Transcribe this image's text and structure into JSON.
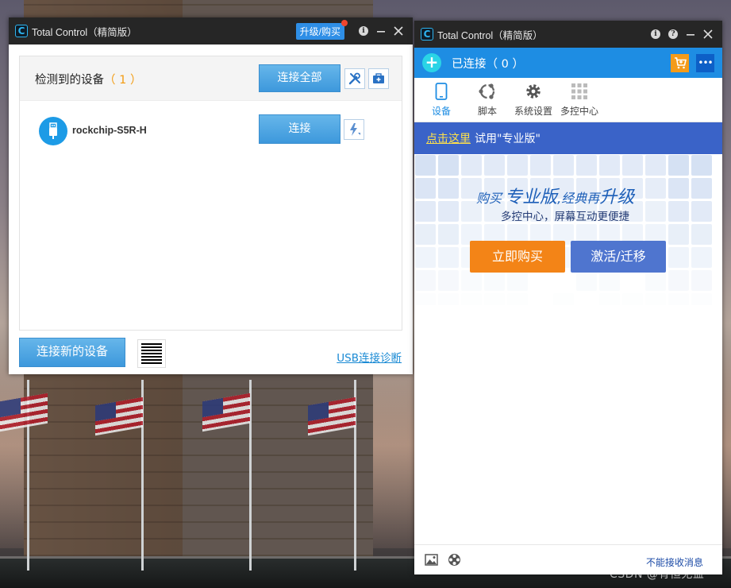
{
  "left_window": {
    "title": "Total Control（精简版）",
    "logo": "C",
    "upgrade_label": "升级/购买",
    "panel": {
      "title": "检测到的设备",
      "count": "（ 1 ）",
      "connect_all_label": "连接全部"
    },
    "devices": [
      {
        "name": "rockchip-S5R-H",
        "connect_label": "连接"
      }
    ],
    "connect_new_label": "连接新的设备",
    "usb_diag_label": "USB连接诊断"
  },
  "right_window": {
    "title": "Total Control（精简版）",
    "logo": "C",
    "connected_text": "已连接（ 0 ）",
    "tabs": [
      {
        "label": "设备",
        "icon": "phone-icon",
        "active": true
      },
      {
        "label": "脚本",
        "icon": "script-icon",
        "active": false
      },
      {
        "label": "系统设置",
        "icon": "gear-icon",
        "active": false
      },
      {
        "label": "多控中心",
        "icon": "grid-icon",
        "active": false
      }
    ],
    "promo": {
      "link": "点击这里",
      "text": "试用\"专业版\""
    },
    "banner": {
      "title_a": "购买",
      "title_b": "专业版",
      "title_c": ",经典再",
      "title_d": "升级",
      "subtitle": "多控中心，屏幕互动更便捷",
      "buy_label": "立即购买",
      "activate_label": "激活/迁移"
    },
    "footer": {
      "no_msg_label": "不能接收消息"
    }
  },
  "watermark": "CSDN @有恒无益",
  "colors": {
    "accent_blue": "#1e8de3",
    "promo_blue": "#3a63c8",
    "orange": "#f38417",
    "count_orange": "#f39c12"
  }
}
